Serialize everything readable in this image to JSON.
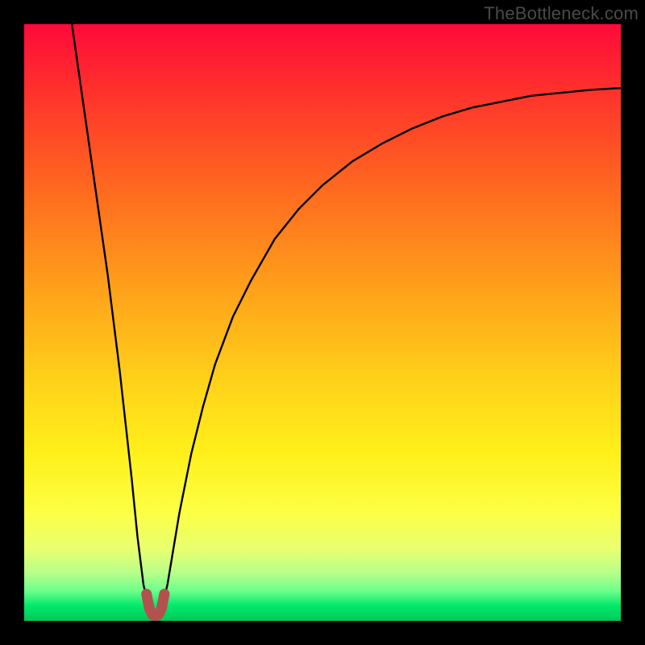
{
  "watermark": "TheBottleneck.com",
  "chart_data": {
    "type": "line",
    "title": "",
    "xlabel": "",
    "ylabel": "",
    "xlim": [
      0,
      100
    ],
    "ylim": [
      0,
      100
    ],
    "grid": false,
    "legend": false,
    "annotations": [],
    "series": [
      {
        "name": "bottleneck-curve",
        "color": "#000000",
        "x": [
          8,
          10,
          12,
          14,
          15,
          16,
          17,
          18,
          19,
          20,
          21,
          22,
          23,
          24,
          25,
          26,
          28,
          30,
          32,
          35,
          38,
          42,
          46,
          50,
          55,
          60,
          65,
          70,
          75,
          80,
          85,
          90,
          95,
          100
        ],
        "y": [
          100,
          86,
          72,
          58,
          50,
          42,
          33,
          24,
          14,
          6,
          2,
          1,
          2,
          6,
          12,
          18,
          28,
          36,
          43,
          51,
          57,
          64,
          69,
          73,
          77,
          80,
          82.5,
          84.5,
          86,
          87,
          88,
          88.5,
          89,
          89.3
        ]
      },
      {
        "name": "minimum-marker",
        "color": "#b3514f",
        "x": [
          20.5,
          21,
          21.5,
          22,
          22.5,
          23,
          23.5
        ],
        "y": [
          4.5,
          2,
          1,
          0.8,
          1,
          2,
          4.5
        ]
      }
    ]
  }
}
